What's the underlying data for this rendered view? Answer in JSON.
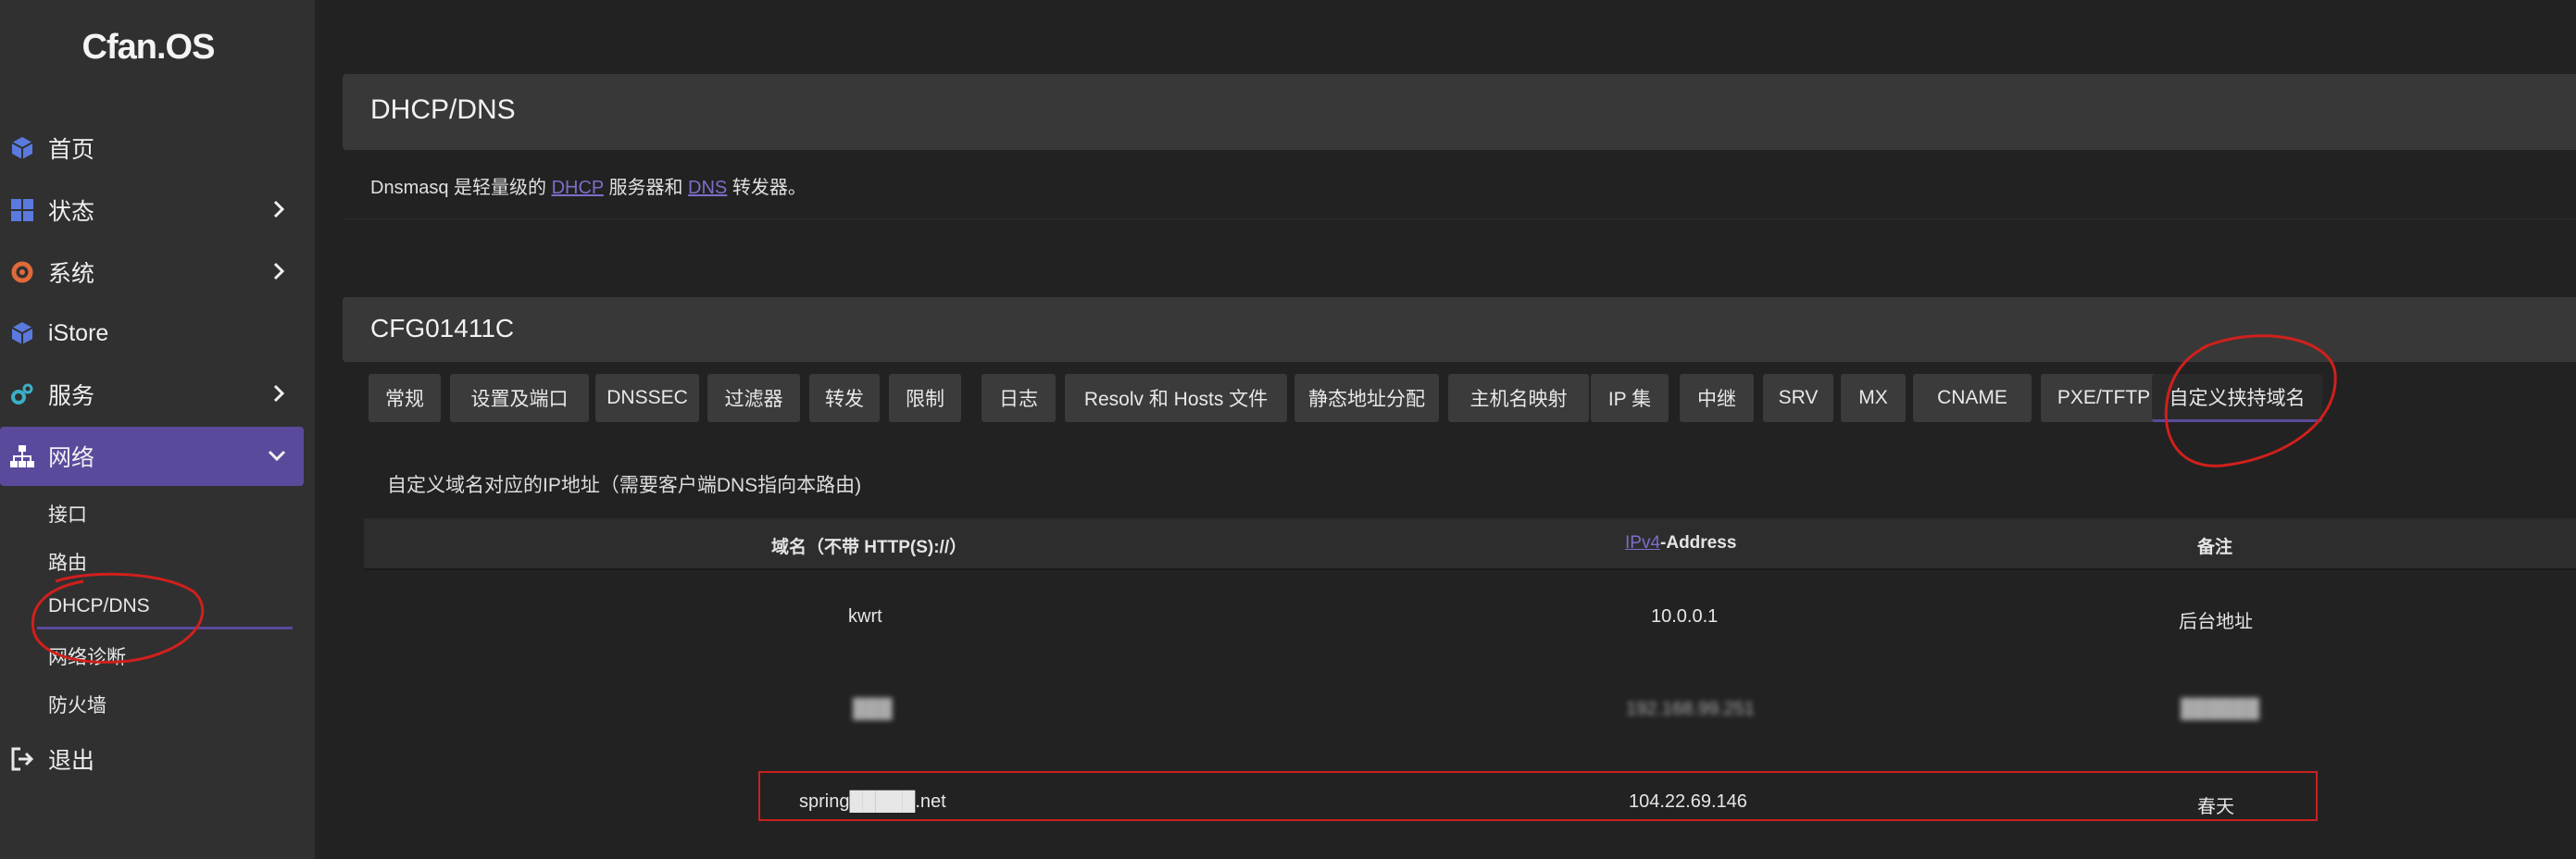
{
  "sidebar": {
    "logo": "Cfan.OS",
    "items": [
      {
        "label": "首页",
        "icon": "cube-icon"
      },
      {
        "label": "状态",
        "icon": "dashboard-icon"
      },
      {
        "label": "系统",
        "icon": "gear-icon"
      },
      {
        "label": "iStore",
        "icon": "cube-icon"
      },
      {
        "label": "服务",
        "icon": "cogs-icon"
      },
      {
        "label": "网络",
        "icon": "sitemap-icon"
      },
      {
        "label": "退出",
        "icon": "logout-icon"
      }
    ],
    "network_sub": [
      "接口",
      "路由",
      "DHCP/DNS",
      "网络诊断",
      "防火墙"
    ]
  },
  "header": {
    "title": "DHCP/DNS",
    "desc_prefix": "Dnsmasq 是轻量级的 ",
    "desc_link1": "DHCP",
    "desc_mid": " 服务器和 ",
    "desc_link2": "DNS",
    "desc_suffix": " 转发器。"
  },
  "section": {
    "title": "CFG01411C",
    "tabs": [
      "常规",
      "设置及端口",
      "DNSSEC",
      "过滤器",
      "转发",
      "限制",
      "日志",
      "Resolv 和 Hosts 文件",
      "静态地址分配",
      "主机名映射",
      "IP 集",
      "中继",
      "SRV",
      "MX",
      "CNAME",
      "PXE/TFTP",
      "自定义挟持域名"
    ],
    "active_tab": "自定义挟持域名",
    "note": "自定义域名对应的IP地址（需要客户端DNS指向本路由)"
  },
  "table": {
    "col1": "域名（不带 HTTP(S)://）",
    "col2_link": "IPv4",
    "col2_rest": "-Address",
    "col3": "备注",
    "rows": [
      {
        "domain": "kwrt",
        "ip": "10.0.0.1",
        "note": "后台地址"
      },
      {
        "domain": "███",
        "ip": "192.168.99.251",
        "note": "██████"
      },
      {
        "domain": "spring█████.net",
        "ip": "104.22.69.146",
        "note": "春天"
      }
    ]
  },
  "colors": {
    "accent": "#5b4a9c",
    "annotation_red": "#d0201c"
  }
}
